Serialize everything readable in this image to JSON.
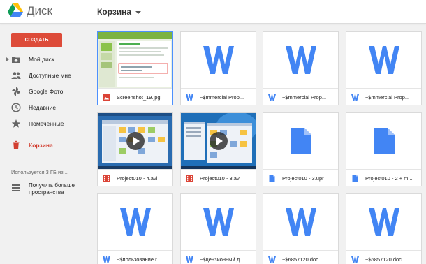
{
  "header": {
    "app_title": "Диск",
    "location": "Корзина"
  },
  "sidebar": {
    "create_label": "СОЗДАТЬ",
    "items": [
      {
        "label": "Мой диск",
        "icon": "folder-icon"
      },
      {
        "label": "Доступные мне",
        "icon": "people-icon"
      },
      {
        "label": "Google Фото",
        "icon": "pinwheel-icon"
      },
      {
        "label": "Недавние",
        "icon": "clock-icon"
      },
      {
        "label": "Помеченные",
        "icon": "star-icon"
      },
      {
        "label": "Корзина",
        "icon": "trash-icon"
      }
    ],
    "storage_text": "Используется 3 ГБ из...",
    "upgrade_label": "Получить больше пространства"
  },
  "files": [
    {
      "name": "Screenshot_19.jpg",
      "type": "image"
    },
    {
      "name": "~$mmercial Prop...",
      "type": "word"
    },
    {
      "name": "~$mmercial Prop...",
      "type": "word"
    },
    {
      "name": "~$mmercial Prop...",
      "type": "word"
    },
    {
      "name": "Project010 - 4.avi",
      "type": "video"
    },
    {
      "name": "Project010 - 3.avi",
      "type": "video"
    },
    {
      "name": "Project010 - 3.upr",
      "type": "doc"
    },
    {
      "name": "Project010 - 2 + m...",
      "type": "doc"
    },
    {
      "name": "~$пользование г...",
      "type": "word"
    },
    {
      "name": "~$цензионный д...",
      "type": "word"
    },
    {
      "name": "~$6857120.doc",
      "type": "word"
    },
    {
      "name": "~$6857120.doc",
      "type": "word"
    }
  ],
  "colors": {
    "accent_red": "#dd4b39",
    "word_blue": "#4285f4",
    "selected_border": "#4d90fe"
  }
}
